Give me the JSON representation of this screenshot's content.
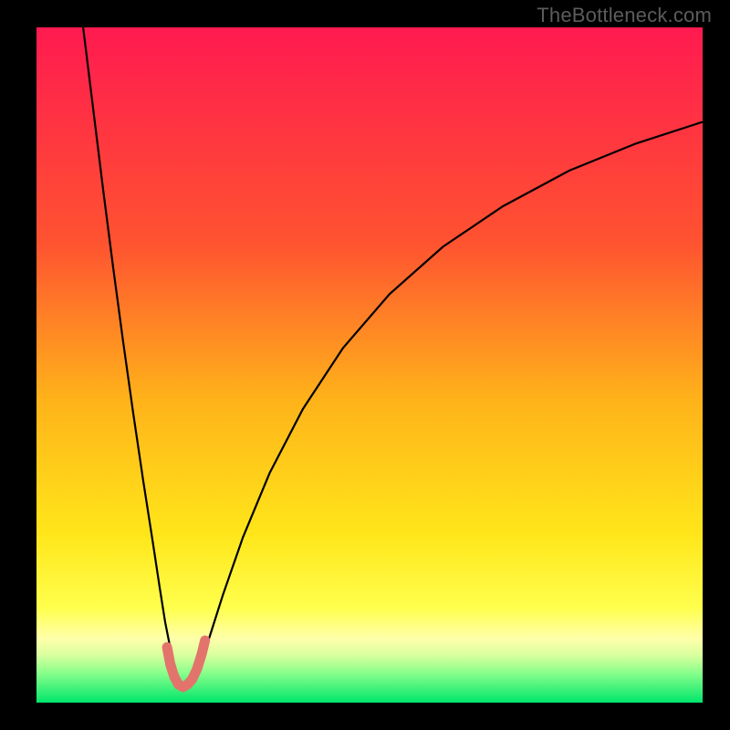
{
  "watermark": "TheBottleneck.com",
  "chart_data": {
    "type": "line",
    "title": "",
    "xlabel": "",
    "ylabel": "",
    "xlim": [
      0,
      100
    ],
    "ylim": [
      0,
      100
    ],
    "gradient_stops": [
      {
        "offset": 0,
        "color": "#ff1a50"
      },
      {
        "offset": 0.32,
        "color": "#ff5330"
      },
      {
        "offset": 0.55,
        "color": "#ffb21a"
      },
      {
        "offset": 0.75,
        "color": "#ffe61a"
      },
      {
        "offset": 0.86,
        "color": "#ffff4d"
      },
      {
        "offset": 0.905,
        "color": "#ffffaa"
      },
      {
        "offset": 0.93,
        "color": "#d8ff9e"
      },
      {
        "offset": 0.955,
        "color": "#8cff8c"
      },
      {
        "offset": 1.0,
        "color": "#00e66b"
      }
    ],
    "series": [
      {
        "name": "left-branch",
        "stroke": "#000000",
        "stroke_width": 2.2,
        "x": [
          7.0,
          8.5,
          10.0,
          11.5,
          13.0,
          14.5,
          16.0,
          17.5,
          18.5,
          19.3,
          20.0,
          20.6,
          21.1,
          21.5,
          21.9,
          22.2
        ],
        "y": [
          100.0,
          88.0,
          76.0,
          64.5,
          53.5,
          43.0,
          33.0,
          23.5,
          17.0,
          12.0,
          8.5,
          6.0,
          4.3,
          3.2,
          2.6,
          2.3
        ]
      },
      {
        "name": "right-branch",
        "stroke": "#000000",
        "stroke_width": 2.2,
        "x": [
          22.2,
          22.8,
          23.6,
          24.6,
          26.0,
          28.0,
          31.0,
          35.0,
          40.0,
          46.0,
          53.0,
          61.0,
          70.0,
          80.0,
          90.0,
          100.0
        ],
        "y": [
          2.3,
          2.8,
          4.0,
          6.0,
          9.8,
          16.0,
          24.5,
          34.0,
          43.5,
          52.5,
          60.5,
          67.5,
          73.5,
          78.8,
          82.8,
          86.0
        ]
      }
    ],
    "u_marker": {
      "stroke": "#e2746c",
      "stroke_width": 11,
      "x": [
        19.6,
        20.1,
        20.7,
        21.3,
        22.0,
        22.7,
        23.4,
        24.1,
        24.8,
        25.3
      ],
      "y": [
        8.2,
        5.6,
        3.8,
        2.7,
        2.3,
        2.7,
        3.5,
        5.0,
        7.2,
        9.2
      ]
    }
  }
}
